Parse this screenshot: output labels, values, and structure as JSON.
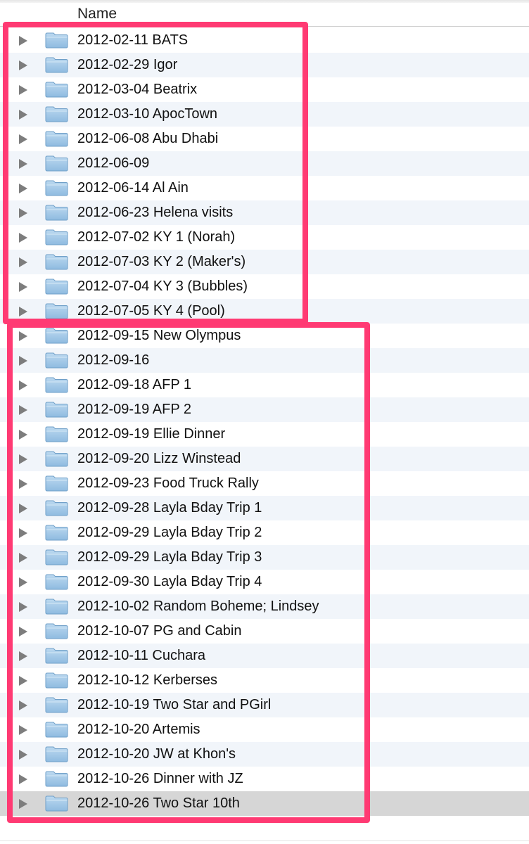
{
  "header": {
    "name_col": "Name"
  },
  "rows": [
    {
      "label": "2012-02-11 BATS",
      "selected": false
    },
    {
      "label": "2012-02-29 Igor",
      "selected": false
    },
    {
      "label": "2012-03-04 Beatrix",
      "selected": false
    },
    {
      "label": "2012-03-10 ApocTown",
      "selected": false
    },
    {
      "label": "2012-06-08 Abu Dhabi",
      "selected": false
    },
    {
      "label": "2012-06-09",
      "selected": false
    },
    {
      "label": "2012-06-14 Al Ain",
      "selected": false
    },
    {
      "label": "2012-06-23 Helena visits",
      "selected": false
    },
    {
      "label": "2012-07-02 KY 1 (Norah)",
      "selected": false
    },
    {
      "label": "2012-07-03 KY 2 (Maker's)",
      "selected": false
    },
    {
      "label": "2012-07-04 KY 3 (Bubbles)",
      "selected": false
    },
    {
      "label": "2012-07-05 KY 4 (Pool)",
      "selected": false
    },
    {
      "label": "2012-09-15 New Olympus",
      "selected": false
    },
    {
      "label": "2012-09-16",
      "selected": false
    },
    {
      "label": "2012-09-18 AFP 1",
      "selected": false
    },
    {
      "label": "2012-09-19 AFP 2",
      "selected": false
    },
    {
      "label": "2012-09-19 Ellie Dinner",
      "selected": false
    },
    {
      "label": "2012-09-20 Lizz Winstead",
      "selected": false
    },
    {
      "label": "2012-09-23 Food Truck Rally",
      "selected": false
    },
    {
      "label": "2012-09-28 Layla Bday Trip 1",
      "selected": false
    },
    {
      "label": "2012-09-29 Layla Bday Trip 2",
      "selected": false
    },
    {
      "label": "2012-09-29 Layla Bday Trip 3",
      "selected": false
    },
    {
      "label": "2012-09-30 Layla Bday Trip 4",
      "selected": false
    },
    {
      "label": "2012-10-02 Random Boheme; Lindsey",
      "selected": false
    },
    {
      "label": "2012-10-07 PG and Cabin",
      "selected": false
    },
    {
      "label": "2012-10-11 Cuchara",
      "selected": false
    },
    {
      "label": "2012-10-12 Kerberses",
      "selected": false
    },
    {
      "label": "2012-10-19 Two Star and PGirl",
      "selected": false
    },
    {
      "label": "2012-10-20 Artemis",
      "selected": false
    },
    {
      "label": "2012-10-20 JW at Khon's",
      "selected": false
    },
    {
      "label": "2012-10-26 Dinner with JZ",
      "selected": false
    },
    {
      "label": "2012-10-26 Two Star 10th",
      "selected": true
    }
  ],
  "icons": {
    "disclosure": "disclosure-triangle-icon",
    "folder": "folder-icon"
  },
  "colors": {
    "alt_row": "#f1f5fa",
    "selected_row": "#d6d6d6",
    "highlight": "#ff3a73",
    "folder_fill": "#a9cdea"
  },
  "annotations": [
    {
      "name": "highlight-box-first-group"
    },
    {
      "name": "highlight-box-second-group"
    }
  ]
}
